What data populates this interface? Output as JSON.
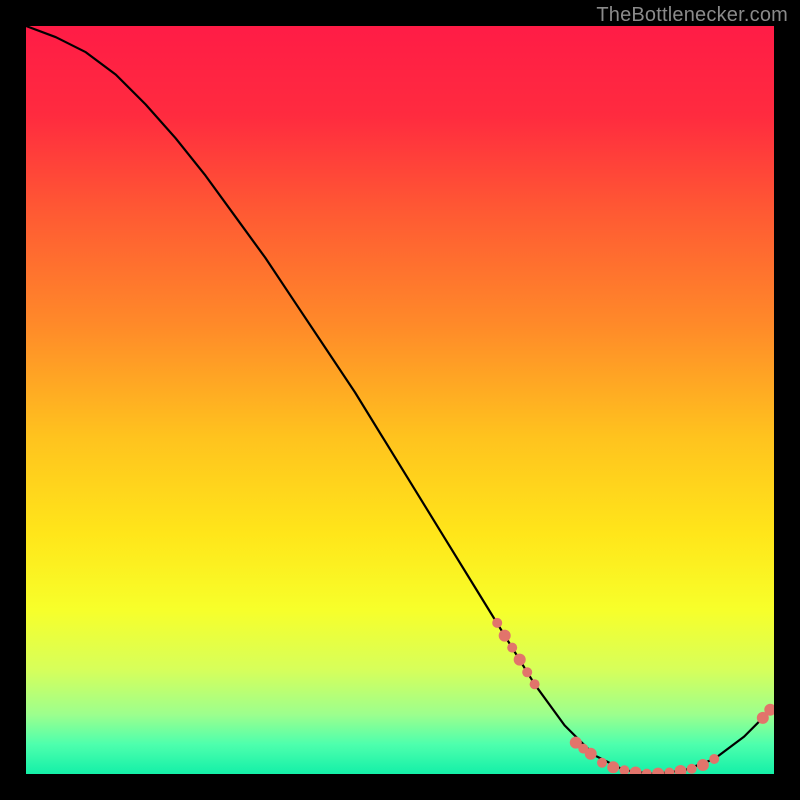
{
  "watermark": "TheBottleneсker.com",
  "gradient": {
    "stops": [
      {
        "offset": 0.0,
        "color": "#ff1c46"
      },
      {
        "offset": 0.12,
        "color": "#ff2b3f"
      },
      {
        "offset": 0.25,
        "color": "#ff5a33"
      },
      {
        "offset": 0.4,
        "color": "#ff8a29"
      },
      {
        "offset": 0.55,
        "color": "#ffc31e"
      },
      {
        "offset": 0.68,
        "color": "#ffe61a"
      },
      {
        "offset": 0.78,
        "color": "#f7ff2a"
      },
      {
        "offset": 0.86,
        "color": "#d7ff5a"
      },
      {
        "offset": 0.92,
        "color": "#9dff8d"
      },
      {
        "offset": 0.96,
        "color": "#4effad"
      },
      {
        "offset": 1.0,
        "color": "#14f0a8"
      }
    ]
  },
  "chart_data": {
    "type": "line",
    "title": "",
    "xlabel": "",
    "ylabel": "",
    "xlim": [
      0,
      100
    ],
    "ylim": [
      0,
      100
    ],
    "series": [
      {
        "name": "curve",
        "x": [
          0,
          4,
          8,
          12,
          16,
          20,
          24,
          28,
          32,
          36,
          40,
          44,
          48,
          52,
          56,
          60,
          64,
          68,
          72,
          76,
          80,
          84,
          88,
          92,
          96,
          100
        ],
        "y": [
          100,
          98.5,
          96.5,
          93.5,
          89.5,
          85,
          80,
          74.5,
          69,
          63,
          57,
          51,
          44.5,
          38,
          31.5,
          25,
          18.5,
          12,
          6.5,
          2.5,
          0.5,
          0,
          0.5,
          2,
          5,
          9
        ]
      }
    ],
    "markers": {
      "name": "highlight-points",
      "color": "#e2746b",
      "points": [
        {
          "x": 63,
          "y": 20.2,
          "r": 5
        },
        {
          "x": 64,
          "y": 18.5,
          "r": 6
        },
        {
          "x": 65,
          "y": 16.9,
          "r": 5
        },
        {
          "x": 66,
          "y": 15.3,
          "r": 6
        },
        {
          "x": 67,
          "y": 13.6,
          "r": 5
        },
        {
          "x": 68,
          "y": 12.0,
          "r": 5
        },
        {
          "x": 73.5,
          "y": 4.2,
          "r": 6
        },
        {
          "x": 74.5,
          "y": 3.4,
          "r": 5
        },
        {
          "x": 75.5,
          "y": 2.7,
          "r": 6
        },
        {
          "x": 77,
          "y": 1.5,
          "r": 5
        },
        {
          "x": 78.5,
          "y": 0.9,
          "r": 6
        },
        {
          "x": 80,
          "y": 0.5,
          "r": 5
        },
        {
          "x": 81.5,
          "y": 0.2,
          "r": 6
        },
        {
          "x": 83,
          "y": 0.05,
          "r": 5
        },
        {
          "x": 84.5,
          "y": 0.05,
          "r": 6
        },
        {
          "x": 86,
          "y": 0.2,
          "r": 5
        },
        {
          "x": 87.5,
          "y": 0.4,
          "r": 6
        },
        {
          "x": 89,
          "y": 0.7,
          "r": 5
        },
        {
          "x": 90.5,
          "y": 1.2,
          "r": 6
        },
        {
          "x": 92,
          "y": 2.0,
          "r": 5
        },
        {
          "x": 98.5,
          "y": 7.5,
          "r": 6
        },
        {
          "x": 99.5,
          "y": 8.6,
          "r": 6
        }
      ]
    }
  }
}
